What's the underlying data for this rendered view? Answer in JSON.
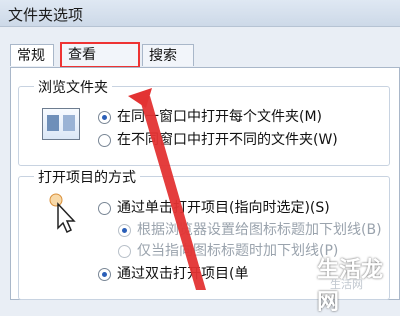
{
  "window": {
    "title": "文件夹选项"
  },
  "tabs": [
    {
      "label": "常规"
    },
    {
      "label": "查看"
    },
    {
      "label": "搜索"
    }
  ],
  "browse_group": {
    "legend": "浏览文件夹",
    "options": [
      {
        "label": "在同一窗口中打开每个文件夹(M)",
        "checked": true
      },
      {
        "label": "在不同窗口中打开不同的文件夹(W)",
        "checked": false
      }
    ]
  },
  "open_group": {
    "legend": "打开项目的方式",
    "options": [
      {
        "label": "通过单击打开项目(指向时选定)(S)",
        "checked": false
      },
      {
        "label": "根据浏览器设置给图标标题加下划线(B)",
        "checked": true,
        "disabled": true
      },
      {
        "label": "仅当指向图标标题时加下划线(P)",
        "checked": false,
        "disabled": true
      },
      {
        "label": "通过双击打开项目(单",
        "checked": true
      }
    ]
  },
  "watermark": {
    "text": "生活龙网",
    "sub": "生活网"
  },
  "colors": {
    "highlight": "#e33333",
    "accent": "#2b5fb8"
  }
}
